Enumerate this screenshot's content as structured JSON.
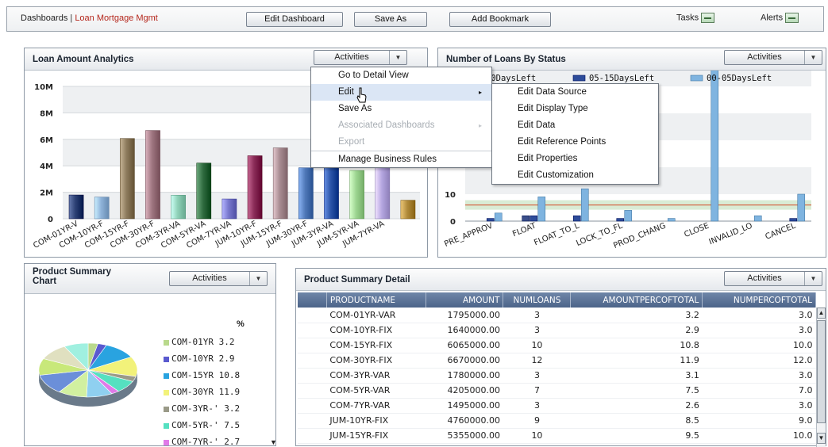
{
  "topbar": {
    "crumb_root": "Dashboards",
    "crumb_sep": "|",
    "crumb_active": "Loan Mortgage Mgmt",
    "edit_dashboard": "Edit Dashboard",
    "save_as": "Save As",
    "add_bookmark": "Add Bookmark",
    "tasks": "Tasks",
    "alerts": "Alerts"
  },
  "activities_label": "Activities",
  "loan_panel": {
    "title": "Loan Amount Analytics",
    "chart_data": {
      "type": "bar",
      "categories": [
        "COM-01YR-V",
        "COM-10YR-F",
        "COM-15YR-F",
        "COM-30YR-F",
        "COM-3YR-VA",
        "COM-5YR-VA",
        "COM-7YR-VA",
        "JUM-10YR-F",
        "JUM-15YR-F",
        "JUM-30YR-F",
        "JUM-3YR-VA",
        "JUM-5YR-VA",
        "JUM-7YR-VA"
      ],
      "values": [
        1795000,
        1640000,
        6065000,
        6670000,
        1780000,
        4205000,
        1495000,
        4760000,
        5355000,
        3850000,
        9300000,
        3650000,
        5100000,
        1400000
      ],
      "ytick_labels": [
        "0",
        "2M",
        "4M",
        "6M",
        "8M",
        "10M"
      ],
      "ylim": [
        0,
        10000000
      ],
      "colors": [
        "#2b3f73",
        "#8fb3d9",
        "#8c7a5c",
        "#9e7580",
        "#8fd1b8",
        "#2f6b3f",
        "#7777cc",
        "#8a2b57",
        "#a88c92",
        "#4f78b8",
        "#2b54a8",
        "#9bd48f",
        "#b5a6e0",
        "#b08a3a"
      ]
    }
  },
  "status_panel": {
    "title": "Number of Loans By Status",
    "legend": [
      {
        "label": "30DaysLeft",
        "color": "#3b4f8a"
      },
      {
        "label": "05-15DaysLeft",
        "color": "#2d4c9a"
      },
      {
        "label": "00-05DaysLeft",
        "color": "#7fb4e0"
      }
    ],
    "chart_data": {
      "type": "bar",
      "categories": [
        "PRE_APPROV",
        "FLOAT",
        "FLOAT_TO_L",
        "LOCK_TO_FL",
        "PROD_CHANG",
        "CLOSE",
        "INVALID_LO",
        "CANCEL"
      ],
      "series": [
        {
          "name": "30DaysLeft",
          "values": [
            0,
            2,
            0,
            0,
            0,
            0,
            0,
            0
          ]
        },
        {
          "name": "05-15DaysLeft",
          "values": [
            1,
            2,
            2,
            1,
            0,
            0,
            0,
            1
          ]
        },
        {
          "name": "00-05DaysLeft",
          "values": [
            3,
            9,
            12,
            4,
            1,
            56,
            2,
            10
          ]
        }
      ],
      "ytick_labels": [
        "0",
        "10"
      ],
      "reference_line": 6
    }
  },
  "activities_menu": {
    "items": [
      {
        "label": "Go to Detail View",
        "disabled": false,
        "submenu": false
      },
      {
        "label": "Edit",
        "disabled": false,
        "submenu": true
      },
      {
        "label": "Save As",
        "disabled": false,
        "submenu": false
      },
      {
        "label": "Associated Dashboards",
        "disabled": true,
        "submenu": true
      },
      {
        "label": "Export",
        "disabled": true,
        "submenu": false
      },
      {
        "label": "Manage Business Rules",
        "disabled": false,
        "submenu": false
      }
    ],
    "arrow": "▸"
  },
  "edit_submenu": {
    "items": [
      "Edit Data Source",
      "Edit Display Type",
      "Edit Data",
      "Edit Reference Points",
      "Edit Properties",
      "Edit Customization"
    ]
  },
  "summary_chart_panel": {
    "title_line1": "Product Summary",
    "title_line2": "Chart",
    "percent_header": "%",
    "legend": [
      {
        "label": "COM-01YR",
        "value": "3.2",
        "color": "#b9d98c"
      },
      {
        "label": "COM-10YR",
        "value": "2.9",
        "color": "#5a5acf"
      },
      {
        "label": "COM-15YR",
        "value": "10.8",
        "color": "#29a3e0"
      },
      {
        "label": "COM-30YR",
        "value": "11.9",
        "color": "#f2f27a"
      },
      {
        "label": "COM-3YR-'",
        "value": "3.2",
        "color": "#9a9a88"
      },
      {
        "label": "COM-5YR-'",
        "value": "7.5",
        "color": "#55e0c0"
      },
      {
        "label": "COM-7YR-'",
        "value": "2.7",
        "color": "#e07ae8"
      }
    ],
    "pie_colors": [
      "#b9d98c",
      "#5a5acf",
      "#29a3e0",
      "#f2f27a",
      "#9a9a88",
      "#55e0c0",
      "#e07ae8",
      "#8fd0f0",
      "#d1f0a0",
      "#6b8fd9",
      "#c8e87a",
      "#e0e0c0",
      "#a0f0e0",
      "#f0c0f0"
    ]
  },
  "summary_detail_panel": {
    "title": "Product Summary Detail",
    "columns": [
      "PRODUCTNAME",
      "AMOUNT",
      "NUMLOANS",
      "AMOUNTPERCOFTOTAL",
      "NUMPERCOFTOTAL"
    ],
    "rows": [
      [
        "COM-01YR-VAR",
        "1795000.00",
        "3",
        "3.2",
        "3.0"
      ],
      [
        "COM-10YR-FIX",
        "1640000.00",
        "3",
        "2.9",
        "3.0"
      ],
      [
        "COM-15YR-FIX",
        "6065000.00",
        "10",
        "10.8",
        "10.0"
      ],
      [
        "COM-30YR-FIX",
        "6670000.00",
        "12",
        "11.9",
        "12.0"
      ],
      [
        "COM-3YR-VAR",
        "1780000.00",
        "3",
        "3.1",
        "3.0"
      ],
      [
        "COM-5YR-VAR",
        "4205000.00",
        "7",
        "7.5",
        "7.0"
      ],
      [
        "COM-7YR-VAR",
        "1495000.00",
        "3",
        "2.6",
        "3.0"
      ],
      [
        "JUM-10YR-FIX",
        "4760000.00",
        "9",
        "8.5",
        "9.0"
      ],
      [
        "JUM-15YR-FIX",
        "5355000.00",
        "10",
        "9.5",
        "10.0"
      ]
    ]
  }
}
